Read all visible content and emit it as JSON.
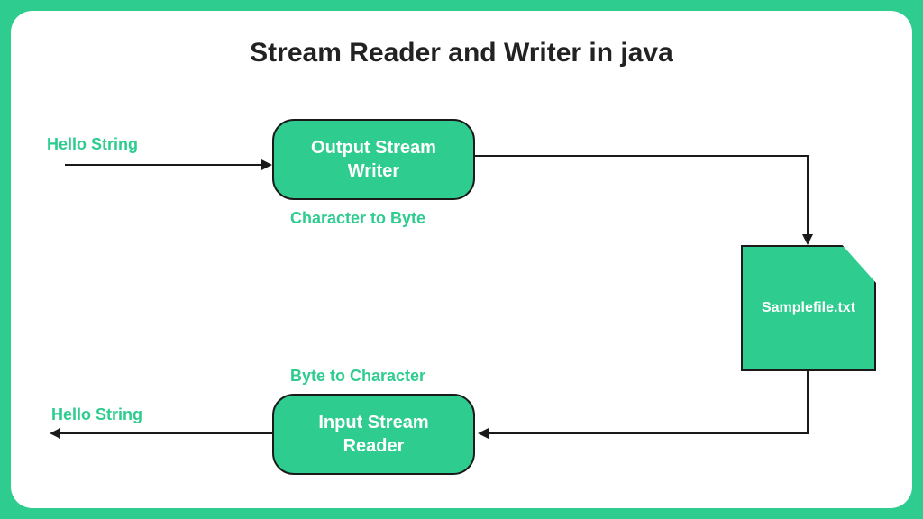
{
  "title": "Stream Reader and Writer in java",
  "input_label": "Hello String",
  "output_label": "Hello String",
  "writer_box": "Output Stream\nWriter",
  "writer_caption": "Character to Byte",
  "reader_box": "Input Stream\nReader",
  "reader_caption": "Byte to Character",
  "file_label": "Samplefile.txt",
  "colors": {
    "accent": "#2ecc8f",
    "text": "#222222"
  }
}
